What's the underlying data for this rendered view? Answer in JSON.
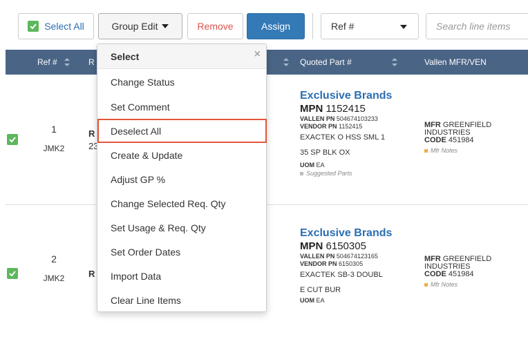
{
  "toolbar": {
    "select_all": "Select All",
    "group_edit": "Group Edit",
    "remove": "Remove",
    "assign": "Assign",
    "sort_value": "Ref #",
    "search_placeholder": "Search line items"
  },
  "table": {
    "headers": {
      "ref": "Ref #",
      "req": "R",
      "quoted_part": "Quoted Part #",
      "vallen": "Vallen MFR/VEN"
    },
    "rows": [
      {
        "ref_num": "1",
        "ref_code": "JMK2",
        "req_label": "R",
        "req_sub": "23",
        "brand": "Exclusive Brands",
        "mpn_label": "MPN",
        "mpn_value": "1152415",
        "vallen_pn_label": "VALLEN PN",
        "vallen_pn_value": "504674103233",
        "vendor_pn_label": "VENDOR PN",
        "vendor_pn_value": "1152415",
        "desc_1": "EXACTEK O HSS SML 1",
        "desc_2": "35 SP BLK OX",
        "uom_label": "UOM",
        "uom_value": "EA",
        "suggested": "Suggested Parts",
        "mfr_label": "MFR",
        "mfr_value": "GREENFIELD INDUSTRIES",
        "code_label": "CODE",
        "code_value": "451984",
        "mfr_notes": "Mfr Notes"
      },
      {
        "ref_num": "2",
        "ref_code": "JMK2",
        "req_label": "R",
        "brand": "Exclusive Brands",
        "mpn_label": "MPN",
        "mpn_value": "6150305",
        "vallen_pn_label": "VALLEN PN",
        "vallen_pn_value": "504674123165",
        "vendor_pn_label": "VENDOR PN",
        "vendor_pn_value": "6150305",
        "desc_1": "EXACTEK SB-3 DOUBL",
        "desc_2": "E CUT BUR",
        "uom_label": "UOM",
        "uom_value": "EA",
        "mfr_label": "MFR",
        "mfr_value": "GREENFIELD INDUSTRIES",
        "code_label": "CODE",
        "code_value": "451984",
        "mfr_notes": "Mfr Notes"
      }
    ]
  },
  "dropdown": {
    "header": "Select",
    "close": "×",
    "items": [
      "Change Status",
      "Set Comment",
      "Deselect All",
      "Create & Update",
      "Adjust GP %",
      "Change Selected Req. Qty",
      "Set Usage & Req. Qty",
      "Set Order Dates",
      "Import Data",
      "Clear Line Items"
    ],
    "highlighted_item": "Deselect All"
  },
  "colors": {
    "header_bg": "#4a6485",
    "brand_link": "#2a6db3",
    "checkbox": "#5cb85c",
    "assign_btn": "#337ab7",
    "remove_text": "#d9534f",
    "highlight_border": "#e2553a"
  },
  "icons": {
    "checkbox": "check-icon",
    "caret": "caret-down-icon",
    "sort": "sort-arrows-icon",
    "close": "close-icon"
  }
}
